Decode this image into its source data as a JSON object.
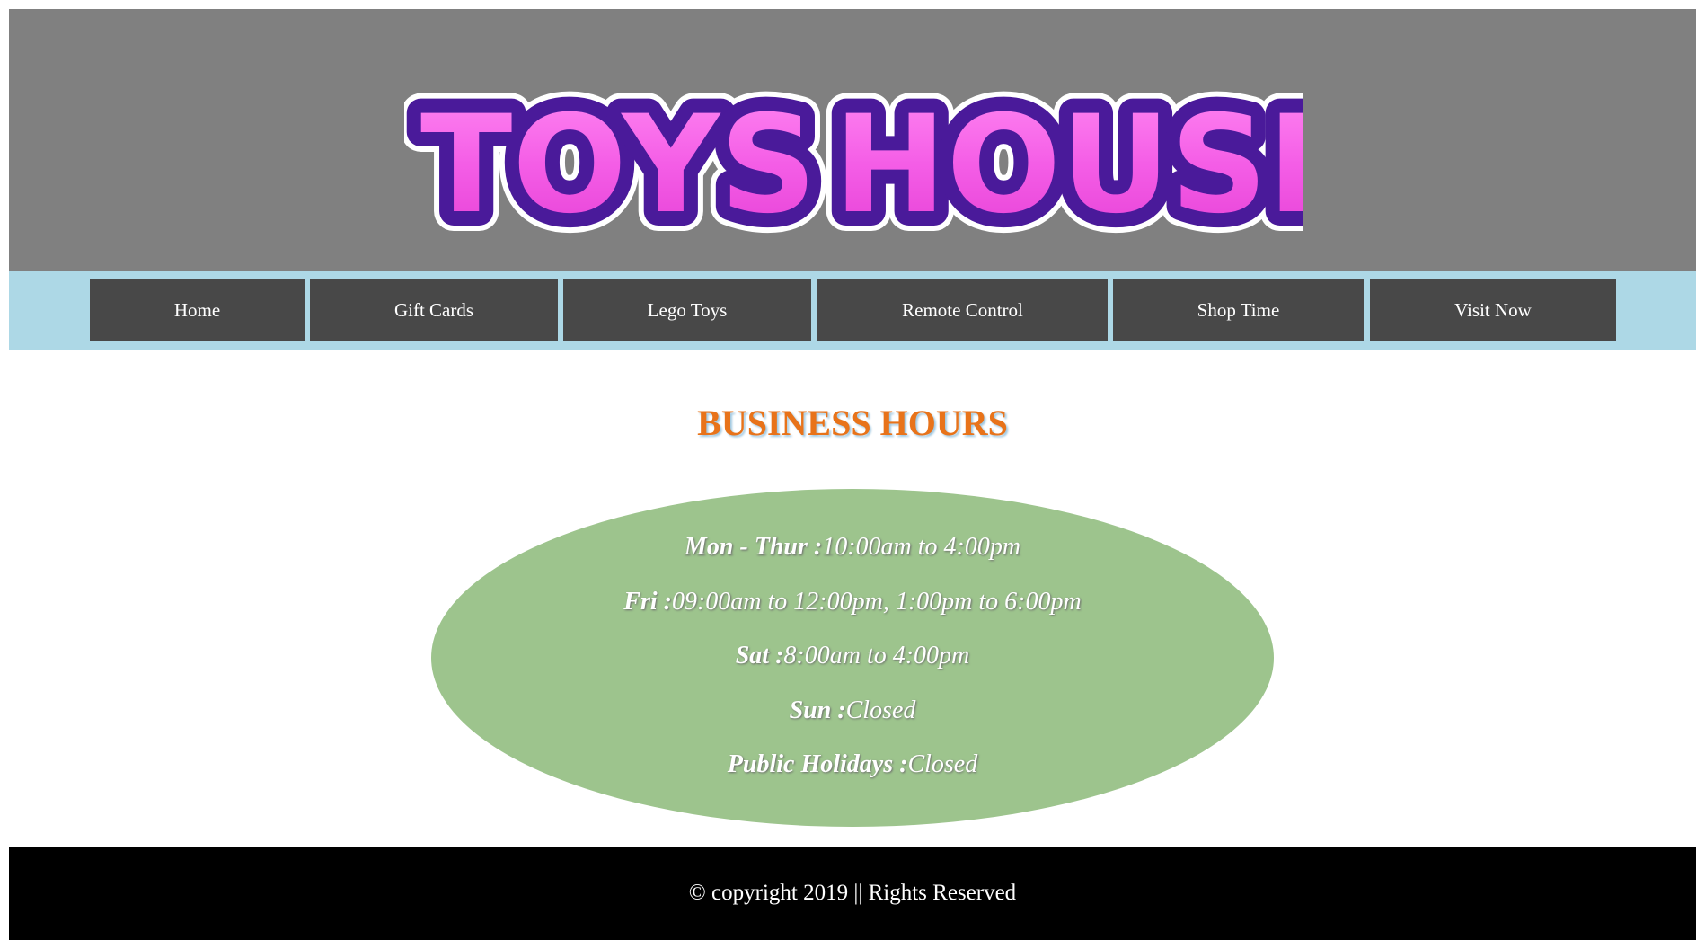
{
  "header": {
    "logo_text": "TOYS HOUSE",
    "logo_word1": "TOYS",
    "logo_word2": "HOUSE",
    "background_color": "#808080",
    "logo_fill_color": "#f65ee8",
    "logo_outline_color": "#4a1a9a"
  },
  "nav": {
    "background_color": "#add8e6",
    "item_color": "#484848",
    "items": [
      {
        "label": "Home"
      },
      {
        "label": "Gift Cards"
      },
      {
        "label": "Lego Toys"
      },
      {
        "label": "Remote Control"
      },
      {
        "label": "Shop Time"
      },
      {
        "label": "Visit Now"
      }
    ]
  },
  "main": {
    "title": "BUSINESS HOURS",
    "title_color": "#e8731a",
    "ellipse_color": "#9dc48d",
    "hours": [
      {
        "day": "Mon - Thur :",
        "time": "10:00am to 4:00pm"
      },
      {
        "day": "Fri :",
        "time": "09:00am to 12:00pm, 1:00pm to 6:00pm"
      },
      {
        "day": "Sat :",
        "time": "8:00am to 4:00pm"
      },
      {
        "day": "Sun :",
        "time": "Closed"
      },
      {
        "day": "Public Holidays :",
        "time": "Closed"
      }
    ]
  },
  "footer": {
    "text": "© copyright 2019 || Rights Reserved"
  }
}
